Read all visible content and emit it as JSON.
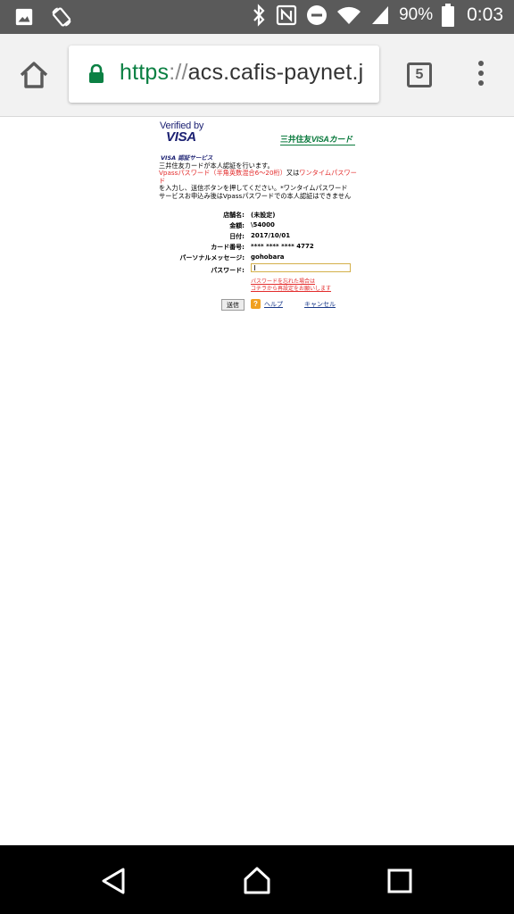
{
  "status_bar": {
    "icons_left": [
      "image-notification-icon",
      "phone-rotate-icon"
    ],
    "icons_right": [
      "bluetooth-icon",
      "nfc-icon",
      "do-not-disturb-icon",
      "wifi-icon",
      "signal-icon"
    ],
    "battery": "90%",
    "time": "0:03"
  },
  "browser": {
    "url_scheme": "https",
    "url_sep": "://",
    "url_host": "acs.cafis-paynet.j",
    "tab_count": "5"
  },
  "page": {
    "vbv_top": "Verified by",
    "vbv_visa": "VISA",
    "bank_logo_jp": "三井住友",
    "bank_logo_visa": "VISAカード",
    "visa_service": "VISA 認証サービス",
    "intro_line1": "三井住友カードが本人認証を行います。",
    "intro_line2_red": "Vpassパスワード（半角英数混合6～20桁）",
    "intro_line2_join": "又は",
    "intro_line2_red2": "ワンタイムパスワー",
    "intro_line3_red": "ド",
    "intro_line4": "を入力し、送信ボタンを押してください。*ワンタイムパスワード",
    "intro_line5": "サービスお申込み後はVpassパスワードでの本人認証はできません",
    "fields": [
      {
        "label": "店舗名:",
        "value": "(未設定)"
      },
      {
        "label": "金額:",
        "value": "\\54000"
      },
      {
        "label": "日付:",
        "value": "2017/10/01"
      },
      {
        "label": "カード番号:",
        "value": "**** **** **** 4772"
      },
      {
        "label": "パーソナルメッセージ:",
        "value": "gohobara"
      },
      {
        "label": "パスワード:",
        "value": ""
      }
    ],
    "forgot_line1": "パスワードを忘れた場合は",
    "forgot_line2": "コチラから再設定をお願いします",
    "submit_label": "送信",
    "help_icon": "?",
    "help_label": "ヘルプ",
    "cancel_label": "キャンセル"
  },
  "colors": {
    "status_bar": "#5a5a5a",
    "toolbar": "#f2f2f2",
    "secure_green": "#0b8043",
    "visa_blue": "#1a1f71",
    "bank_green": "#0a7a3d",
    "warning_red": "#e32b2b",
    "nav_bar": "#000000"
  }
}
